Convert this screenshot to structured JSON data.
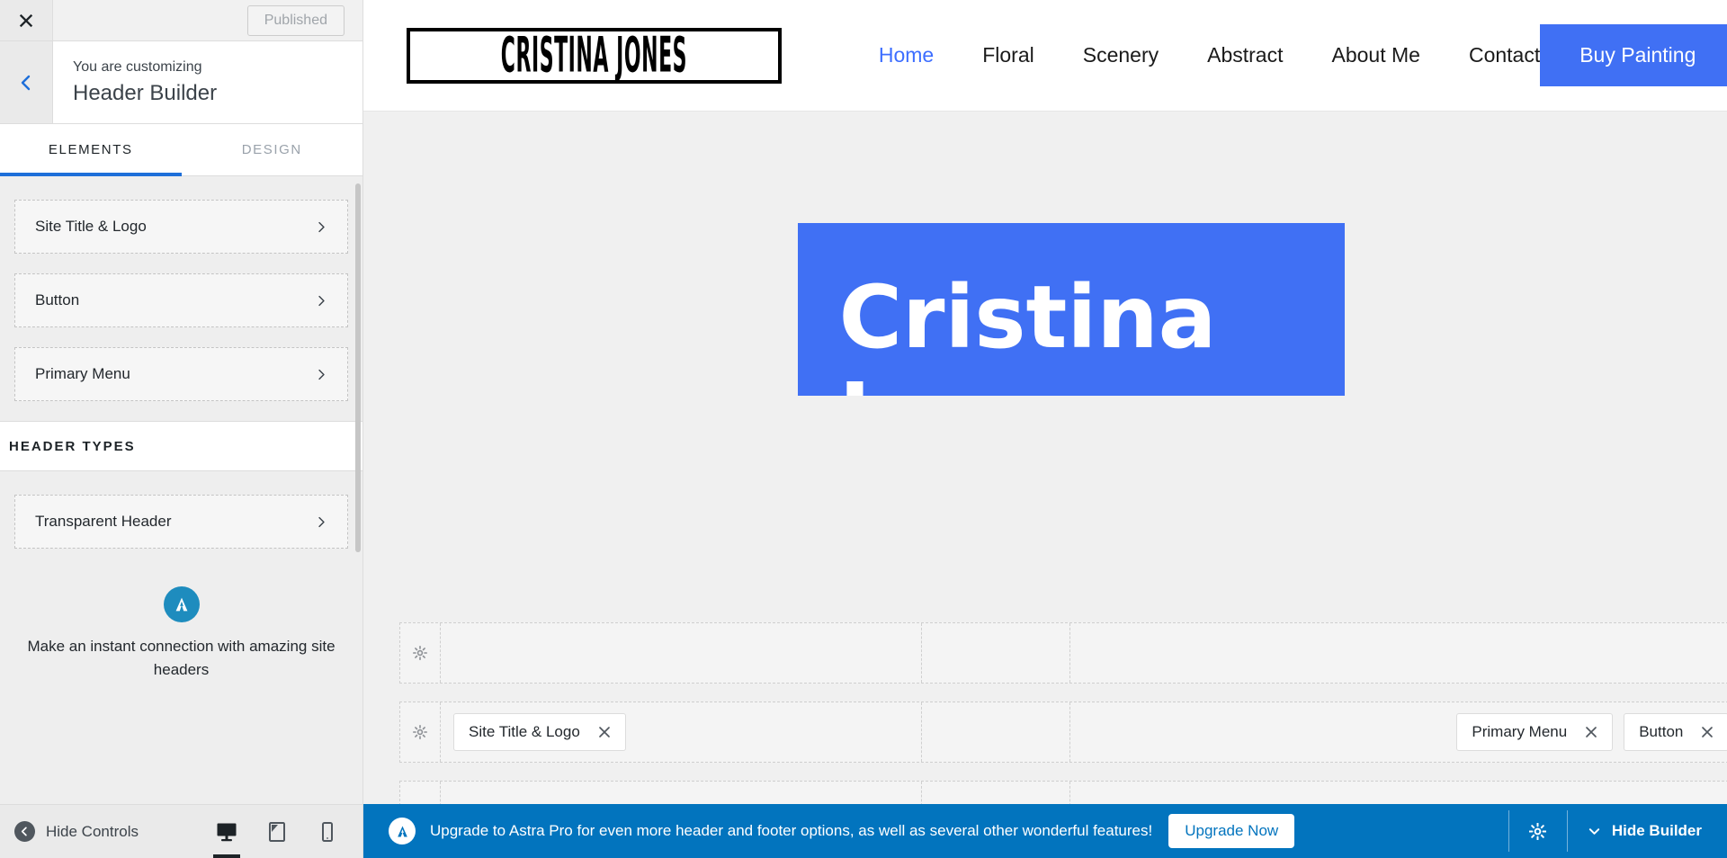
{
  "sidebar": {
    "close_icon": "close-icon",
    "publish": {
      "label": "Published"
    },
    "back_icon": "chevron-left-icon",
    "eyebrow": "You are customizing",
    "title": "Header Builder",
    "tabs": [
      {
        "label": "ELEMENTS",
        "active": true
      },
      {
        "label": "DESIGN",
        "active": false
      }
    ],
    "elements": [
      {
        "label": "Site Title & Logo"
      },
      {
        "label": "Button"
      },
      {
        "label": "Primary Menu"
      }
    ],
    "section_header": "HEADER TYPES",
    "header_types": [
      {
        "label": "Transparent Header"
      }
    ],
    "promo": {
      "logo_icon": "astra-logo-icon",
      "text": "Make an instant connection with amazing site headers"
    },
    "bottom": {
      "hide_controls": "Hide Controls",
      "devices": [
        {
          "name": "desktop-preview",
          "icon": "desktop-icon",
          "active": true
        },
        {
          "name": "tablet-preview",
          "icon": "tablet-icon",
          "active": false
        },
        {
          "name": "mobile-preview",
          "icon": "mobile-icon",
          "active": false
        }
      ]
    }
  },
  "preview": {
    "site": {
      "logo_text": "CRISTINA JONES",
      "nav": [
        {
          "label": "Home",
          "active": true
        },
        {
          "label": "Floral",
          "active": false
        },
        {
          "label": "Scenery",
          "active": false
        },
        {
          "label": "Abstract",
          "active": false
        },
        {
          "label": "About Me",
          "active": false
        },
        {
          "label": "Contact",
          "active": false
        }
      ],
      "cta": {
        "label": "Buy Painting",
        "color": "#4070f4"
      },
      "hero_title": "Cristina Jones"
    },
    "builder": {
      "rows": [
        {
          "name": "above-header-row",
          "gear": "gear-icon",
          "chips": {
            "left": [],
            "right": []
          }
        },
        {
          "name": "primary-header-row",
          "gear": "gear-icon",
          "chips": {
            "left": [
              {
                "label": "Site Title & Logo"
              }
            ],
            "right": [
              {
                "label": "Primary Menu"
              },
              {
                "label": "Button"
              }
            ]
          }
        },
        {
          "name": "below-header-row",
          "gear": "gear-icon",
          "chips": {
            "left": [],
            "right": []
          }
        }
      ]
    }
  },
  "notice": {
    "badge_icon": "astra-logo-icon",
    "text": "Upgrade to Astra Pro for even more header and footer options, as well as several other wonderful features!",
    "upgrade_label": "Upgrade Now",
    "gear_icon": "gear-icon",
    "hide_builder_label": "Hide Builder",
    "bg_color": "#0274be"
  }
}
